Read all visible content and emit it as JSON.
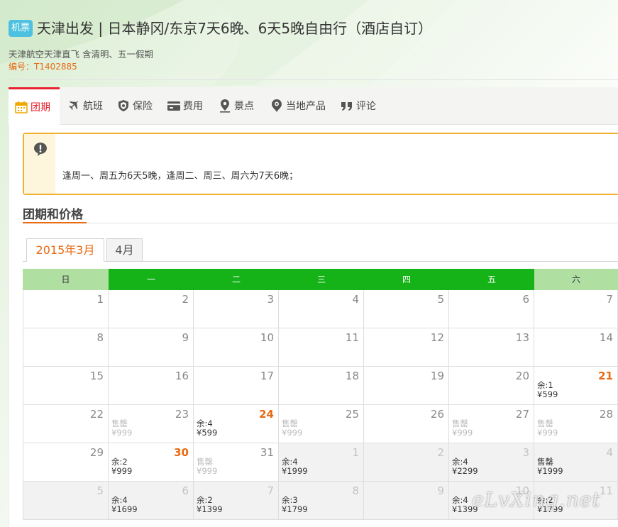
{
  "header": {
    "tag": "机票",
    "title": "天津出发 | 日本静冈/东京7天6晚、6天5晚自由行（酒店自订）",
    "subtitle": "天津航空天津直飞 含清明、五一假期",
    "code": "编号：T1402885"
  },
  "nav": {
    "items": [
      {
        "label": "团期",
        "icon": "calendar-icon",
        "active": true
      },
      {
        "label": "航班",
        "icon": "airplane-icon"
      },
      {
        "label": "保险",
        "icon": "shield-icon"
      },
      {
        "label": "费用",
        "icon": "wallet-icon"
      },
      {
        "label": "景点",
        "icon": "location-pin-icon"
      },
      {
        "label": "当地产品",
        "icon": "local-product-icon"
      },
      {
        "label": "评论",
        "icon": "quote-icon"
      }
    ]
  },
  "notice": {
    "icon": "exclamation-icon",
    "text": "逢周一、周五为6天5晚，逢周二、周三、周六为7天6晚；"
  },
  "section": {
    "title": "团期和价格"
  },
  "month_tabs": [
    {
      "label": "2015年3月",
      "active": true
    },
    {
      "label": "4月",
      "active": false
    }
  ],
  "calendar": {
    "weekdays": [
      "日",
      "一",
      "二",
      "三",
      "四",
      "五",
      "六"
    ],
    "weekend_color": "#b0dfa2",
    "weekday_color": "#15b318",
    "highlight_color": "#e86a14",
    "weeks": [
      [
        {
          "day": "1"
        },
        {
          "day": "2"
        },
        {
          "day": "3"
        },
        {
          "day": "4"
        },
        {
          "day": "5"
        },
        {
          "day": "6"
        },
        {
          "day": "7"
        }
      ],
      [
        {
          "day": "8"
        },
        {
          "day": "9"
        },
        {
          "day": "10"
        },
        {
          "day": "11"
        },
        {
          "day": "12"
        },
        {
          "day": "13"
        },
        {
          "day": "14"
        }
      ],
      [
        {
          "day": "15"
        },
        {
          "day": "16"
        },
        {
          "day": "17"
        },
        {
          "day": "18"
        },
        {
          "day": "19"
        },
        {
          "day": "20"
        },
        {
          "day": "21",
          "highlight": true,
          "line1": "余:1",
          "line2": "¥599"
        }
      ],
      [
        {
          "day": "22"
        },
        {
          "day": "23",
          "line1": "售罄",
          "line2": "¥999",
          "soldout": true
        },
        {
          "day": "24",
          "highlight": true,
          "line1": "余:4",
          "line2": "¥599"
        },
        {
          "day": "25",
          "line1": "售罄",
          "line2": "¥999",
          "soldout": true
        },
        {
          "day": "26"
        },
        {
          "day": "27",
          "line1": "售罄",
          "line2": "¥999",
          "soldout": true
        },
        {
          "day": "28",
          "line1": "售罄",
          "line2": "¥999",
          "soldout": true
        }
      ],
      [
        {
          "day": "29"
        },
        {
          "day": "30",
          "highlight": true,
          "line1": "余:2",
          "line2": "¥999"
        },
        {
          "day": "31",
          "line1": "售罄",
          "line2": "¥999",
          "soldout": true
        },
        {
          "day": "1",
          "other": true,
          "line1": "余:4",
          "line2": "¥1999"
        },
        {
          "day": "2",
          "other": true
        },
        {
          "day": "3",
          "other": true,
          "line1": "余:4",
          "line2": "¥2299"
        },
        {
          "day": "4",
          "other": true,
          "line1": "售罄",
          "line2": "¥1999"
        }
      ],
      [
        {
          "day": "5",
          "other": true
        },
        {
          "day": "6",
          "other": true,
          "line1": "余:4",
          "line2": "¥1699"
        },
        {
          "day": "7",
          "other": true,
          "line1": "余:2",
          "line2": "¥1399"
        },
        {
          "day": "8",
          "other": true,
          "line1": "余:3",
          "line2": "¥1799"
        },
        {
          "day": "9",
          "other": true
        },
        {
          "day": "10",
          "other": true,
          "line1": "余:4",
          "line2": "¥1399"
        },
        {
          "day": "11",
          "other": true,
          "line1": "余:2",
          "line2": "¥1799"
        }
      ]
    ]
  },
  "watermark": "eLvXing.net"
}
